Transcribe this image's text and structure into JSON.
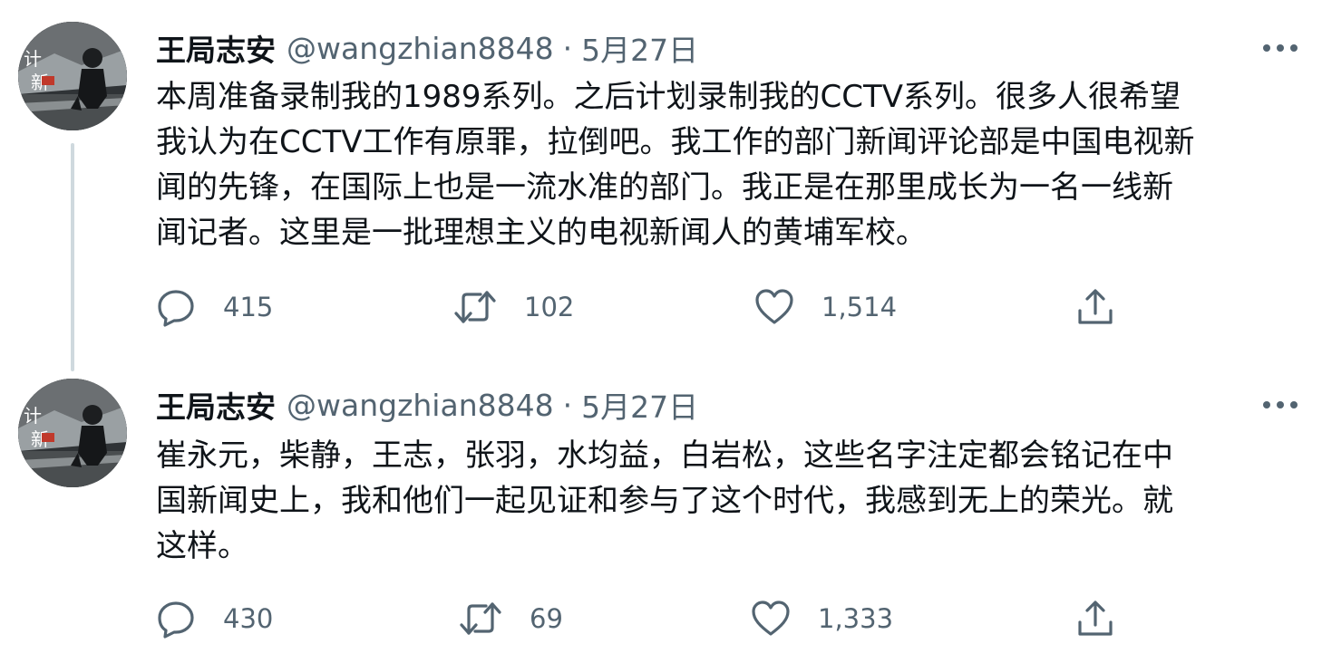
{
  "tweets": [
    {
      "avatar_icon": "profile-photo",
      "name": "王局志安",
      "handle": "@wangzhian8848",
      "separator": "·",
      "date": "5月27日",
      "text": "本周准备录制我的1989系列。之后计划录制我的CCTV系列。很多人很希望\n我认为在CCTV工作有原罪，拉倒吧。我工作的部门新闻评论部是中国电视新\n闻的先锋，在国际上也是一流水准的部门。我正是在那里成长为一名一线新\n闻记者。这里是一批理想主义的电视新闻人的黄埔军校。",
      "replies": "415",
      "retweets": "102",
      "likes": "1,514"
    },
    {
      "avatar_icon": "profile-photo",
      "name": "王局志安",
      "handle": "@wangzhian8848",
      "separator": "·",
      "date": "5月27日",
      "text": "崔永元，柴静，王志，张羽，水均益，白岩松，这些名字注定都会铭记在中\n国新闻史上，我和他们一起见证和参与了这个时代，我感到无上的荣光。就\n这样。",
      "replies": "430",
      "retweets": "69",
      "likes": "1,333"
    }
  ],
  "colors": {
    "text": "#0f1419",
    "secondary": "#536471",
    "thread_line": "#cfd9de"
  }
}
